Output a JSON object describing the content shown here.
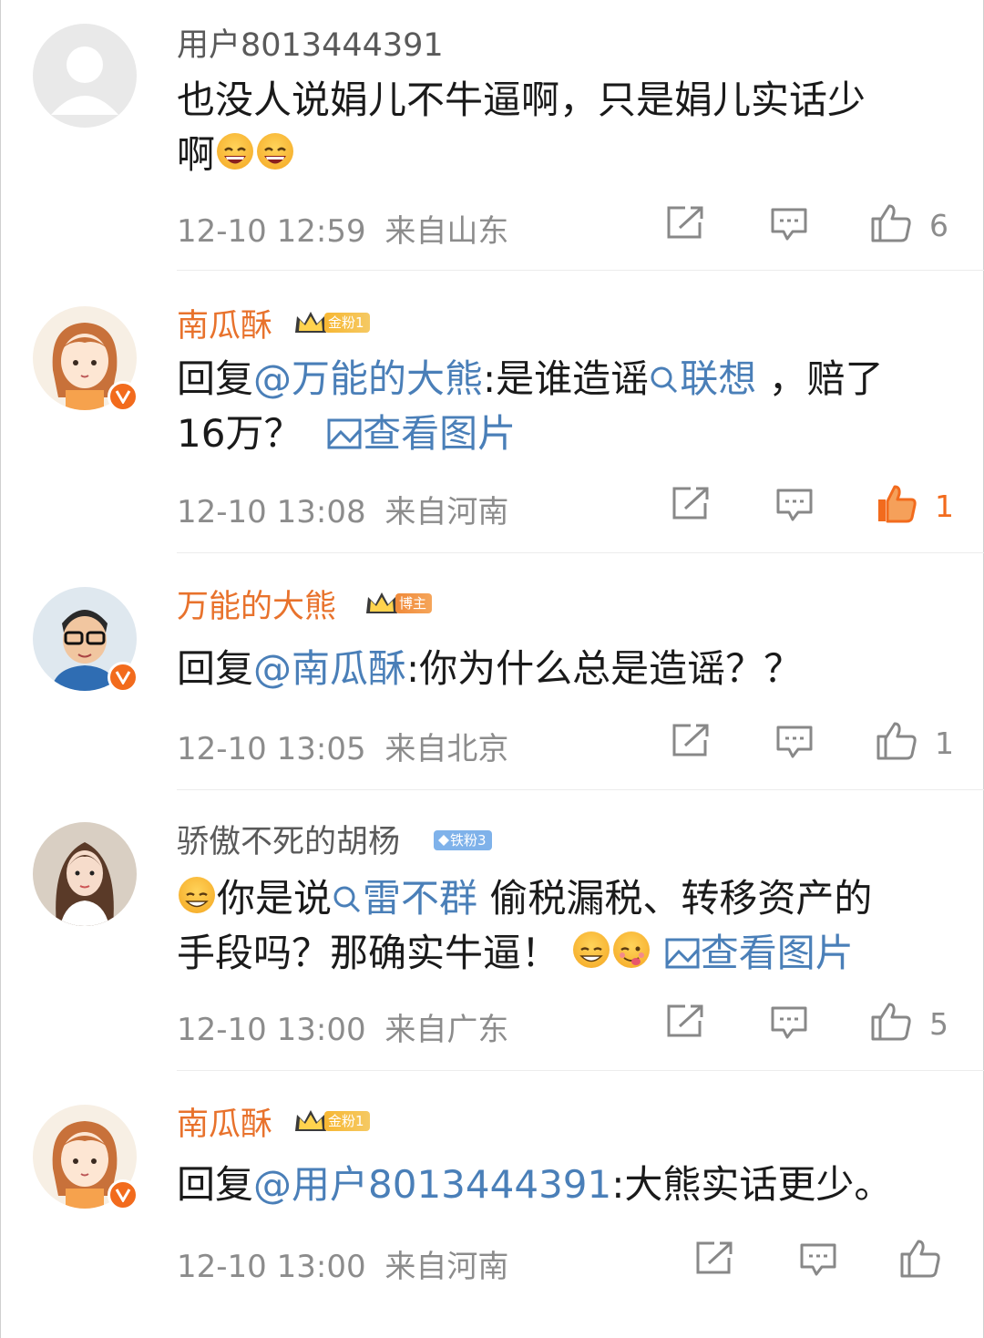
{
  "comments": [
    {
      "username": "用户8013444391",
      "text_main": "也没人说娟儿不牛逼啊，只是娟儿实话少",
      "text_tail": "啊",
      "time": "12-10 12:59",
      "location": "来自山东",
      "likes": "6",
      "liked": false
    },
    {
      "username": "南瓜酥",
      "badge": "金粉1",
      "reply_prefix": "回复",
      "mention": "@万能的大熊",
      "text_a": ":是谁造谣",
      "search_term": "联想",
      "text_b": "，赔了",
      "text_c": "16万？",
      "image_link": "查看图片",
      "time": "12-10 13:08",
      "location": "来自河南",
      "likes": "1",
      "liked": true
    },
    {
      "username": "万能的大熊",
      "badge": "博主",
      "reply_prefix": "回复",
      "mention": "@南瓜酥",
      "text_a": ":你为什么总是造谣？？",
      "time": "12-10 13:05",
      "location": "来自北京",
      "likes": "1",
      "liked": false
    },
    {
      "username": "骄傲不死的胡杨",
      "badge": "铁粉3",
      "text_a": "你是说",
      "search_term": "雷不群",
      "text_b": " 偷税漏税、转移资产的",
      "text_c": "手段吗？那确实牛逼！",
      "image_link": "查看图片",
      "time": "12-10 13:00",
      "location": "来自广东",
      "likes": "5",
      "liked": false
    },
    {
      "username": "南瓜酥",
      "badge": "金粉1",
      "reply_prefix": "回复",
      "mention": "@用户8013444391",
      "text_a": ":大熊实话更少。",
      "time": "12-10 13:00",
      "location": "来自河南",
      "likes": "",
      "liked": false
    }
  ],
  "colors": {
    "username_orange": "#e8722c",
    "link_blue": "#4a7fb8",
    "meta_gray": "#8c8c8c",
    "like_active": "#f26b1d"
  },
  "icons": [
    "default-avatar-icon",
    "repost-icon",
    "comment-icon",
    "like-icon",
    "search-icon",
    "image-icon",
    "crown-icon",
    "diamond-icon",
    "verified-icon",
    "laughing-emoji",
    "grin-emoji",
    "yum-emoji"
  ]
}
